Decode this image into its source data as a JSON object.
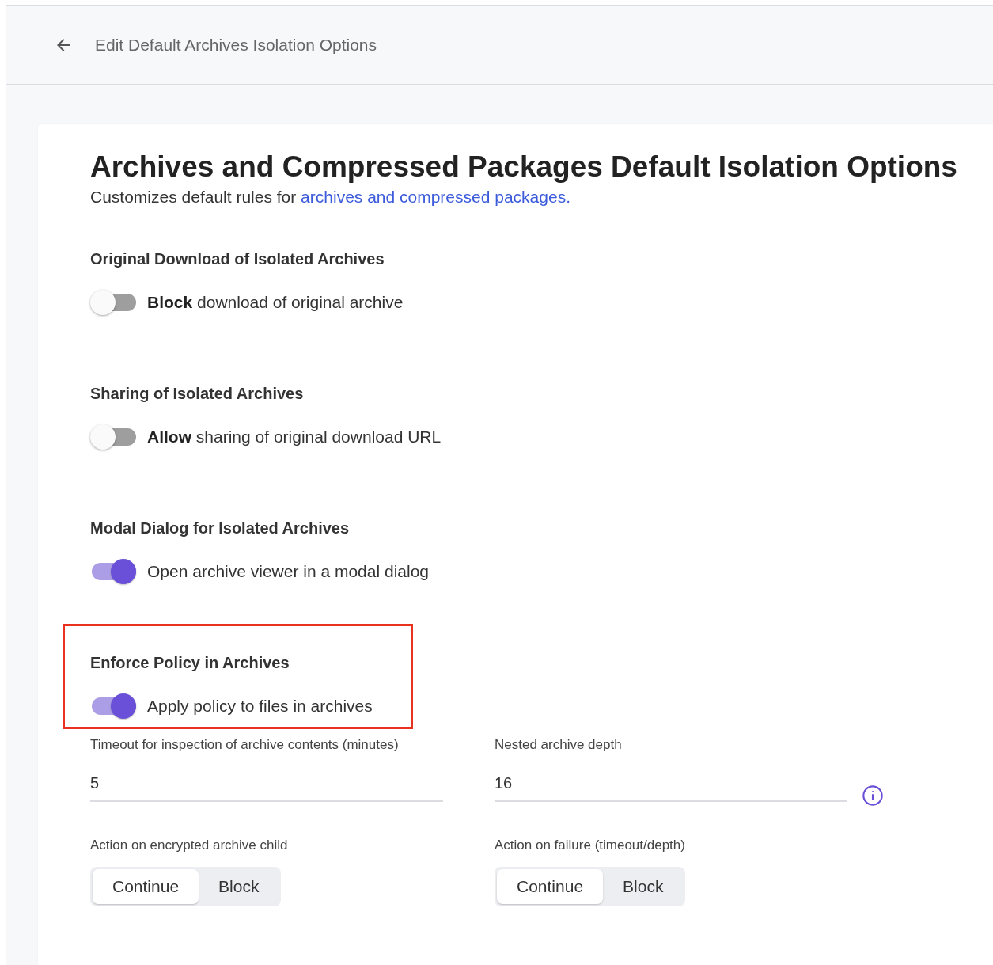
{
  "header": {
    "title": "Edit Default Archives Isolation Options"
  },
  "page": {
    "title": "Archives and Compressed Packages Default Isolation Options",
    "subtitle": "Customizes default rules for",
    "subtitle_link": "archives and compressed packages."
  },
  "sections": [
    {
      "heading": "Original Download of Isolated Archives",
      "toggle_label": "**Block** download of original archive",
      "on": false,
      "highlighted": false
    },
    {
      "heading": "Sharing of Isolated Archives",
      "toggle_label": "**Allow** sharing of original download URL",
      "on": false,
      "highlighted": false
    },
    {
      "heading": "Modal Dialog for Isolated Archives",
      "toggle_label": "Open archive viewer in a modal dialog",
      "on": true,
      "highlighted": false
    },
    {
      "heading": "Enforce Policy in Archives",
      "toggle_label": "Apply policy to files in archives",
      "on": true,
      "highlighted": true
    }
  ],
  "fields": [
    {
      "label": "Timeout for inspection of archive contents (minutes)",
      "value": "5",
      "info": false
    },
    {
      "label": "Nested archive depth",
      "value": "16",
      "info": true
    }
  ],
  "choices": [
    {
      "label": "Action on encrypted archive child",
      "options": [
        {
          "label": "Continue",
          "selected": true
        },
        {
          "label": "Block",
          "selected": false
        }
      ]
    },
    {
      "label": "Action on failure (timeout/depth)",
      "options": [
        {
          "label": "Continue",
          "selected": true
        },
        {
          "label": "Block",
          "selected": false
        }
      ]
    }
  ]
}
